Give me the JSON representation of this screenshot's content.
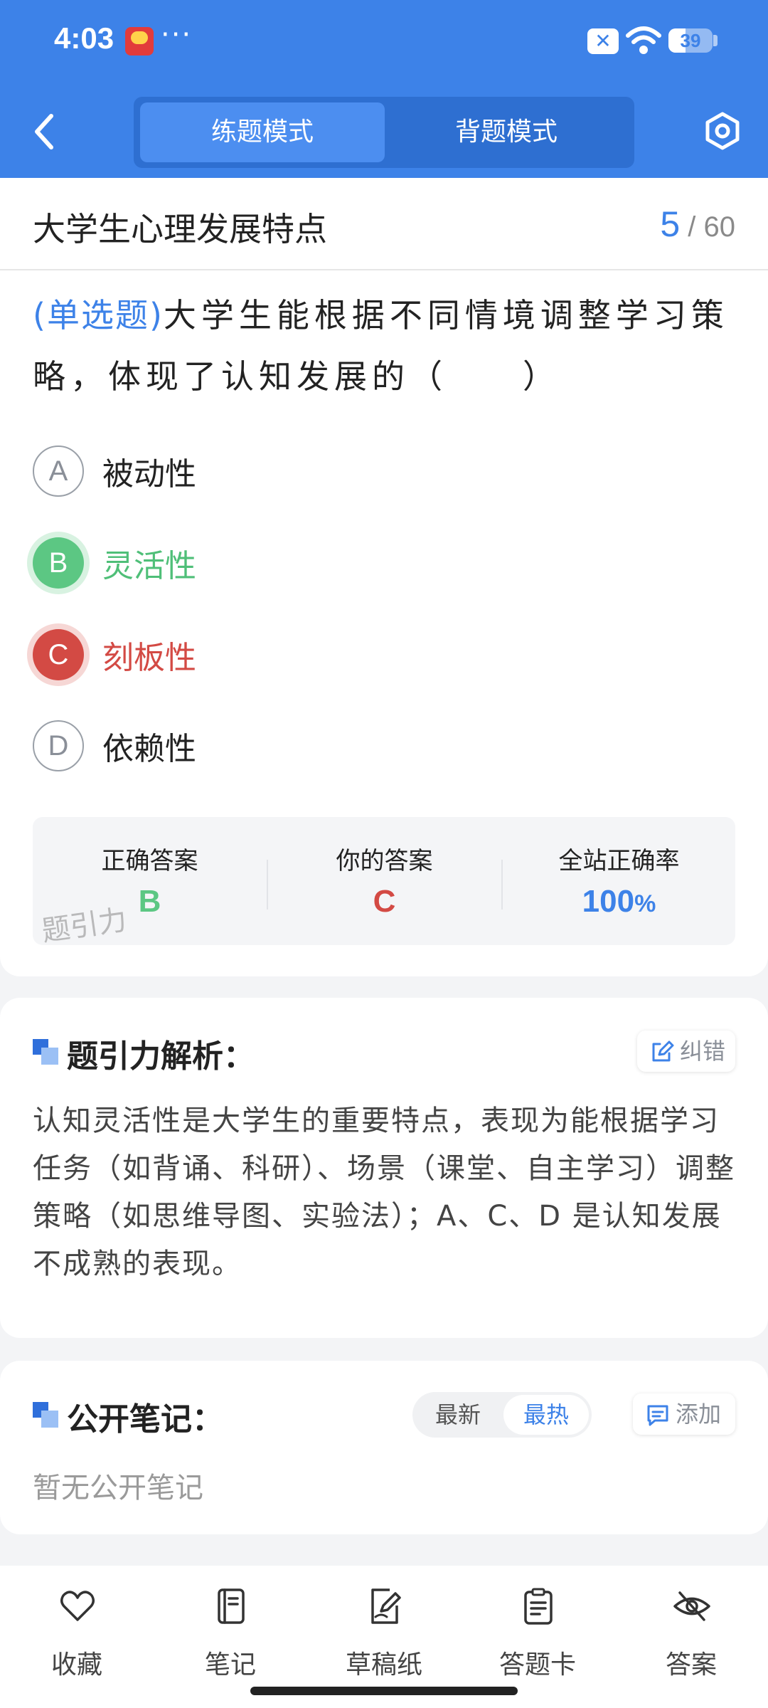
{
  "status_bar": {
    "time": "4:03",
    "more": "···",
    "battery": "39",
    "battery_level": 0.39
  },
  "header": {
    "modes": [
      "练题模式",
      "背题模式"
    ],
    "active_mode": "练题模式"
  },
  "question_card": {
    "section_title": "大学生心理发展特点",
    "current": "5",
    "total": "/ 60",
    "type": "(单选题)",
    "text": "大学生能根据不同情境调整学习策略，体现了认知发展的（　　）",
    "options": [
      {
        "letter": "A",
        "text": "被动性",
        "state": "normal"
      },
      {
        "letter": "B",
        "text": "灵活性",
        "state": "correct"
      },
      {
        "letter": "C",
        "text": "刻板性",
        "state": "wrong"
      },
      {
        "letter": "D",
        "text": "依赖性",
        "state": "normal"
      }
    ],
    "result": {
      "correct_label": "正确答案",
      "correct_value": "B",
      "yours_label": "你的答案",
      "yours_value": "C",
      "rate_label": "全站正确率",
      "rate_value": "100",
      "rate_unit": "%"
    },
    "watermark": "题引力"
  },
  "analysis": {
    "title": "题引力解析：",
    "report_label": "纠错",
    "text": "认知灵活性是大学生的重要特点，表现为能根据学习任务（如背诵、科研）、场景（课堂、自主学习）调整策略（如思维导图、实验法）；A、C、D 是认知发展不成熟的表现。"
  },
  "notes": {
    "title": "公开笔记：",
    "sort_options": [
      "最新",
      "最热"
    ],
    "active_sort": "最热",
    "add_label": "添加",
    "empty_text": "暂无公开笔记"
  },
  "bottom_nav": [
    {
      "label": "收藏",
      "icon": "heart-icon"
    },
    {
      "label": "笔记",
      "icon": "notebook-icon"
    },
    {
      "label": "草稿纸",
      "icon": "draft-paper-icon"
    },
    {
      "label": "答题卡",
      "icon": "answer-card-icon"
    },
    {
      "label": "答案",
      "icon": "eye-off-icon"
    }
  ],
  "colors": {
    "brand": "#3d82e8",
    "correct": "#5cc783",
    "wrong": "#d34a44"
  }
}
